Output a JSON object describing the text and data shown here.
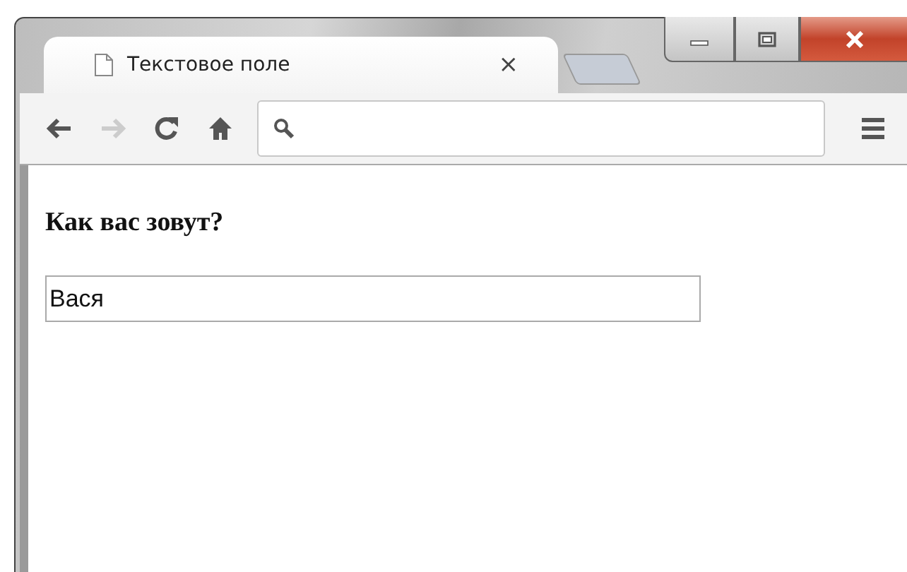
{
  "window": {
    "controls": [
      {
        "kind": "minimize"
      },
      {
        "kind": "maximize"
      },
      {
        "kind": "close"
      }
    ]
  },
  "tabs": [
    {
      "title": "Текстовое поле",
      "selected": true,
      "close": "×"
    }
  ],
  "toolbar": {
    "back_disabled": false,
    "forward_disabled": true
  },
  "page": {
    "heading": "Как вас зовут?",
    "field": {
      "value": "Вася"
    }
  }
}
